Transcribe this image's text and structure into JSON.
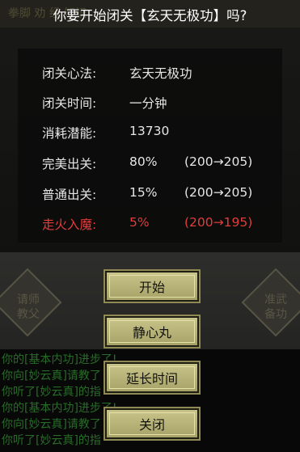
{
  "background": {
    "topbar_text": "拳脚            劝         经     知识",
    "left_badge": "请师\n教父",
    "right_badge": "准武\n备功",
    "log_lines": [
      {
        "text": "你的[基本内功]进步了!",
        "color": "#3fae3f"
      },
      {
        "text": "你向[妙云真]请教了        的疑问。",
        "color": "#3fae3f"
      },
      {
        "text": "你听了[妙云真]的指",
        "color": "#3fae3f"
      },
      {
        "text": "你的[基本内功]进步了!",
        "color": "#3fae3f"
      },
      {
        "text": "你向[妙云真]请教了        的疑问。",
        "color": "#3fae3f"
      },
      {
        "text": "你听了[妙云真]的指",
        "color": "#3fae3f"
      }
    ]
  },
  "dialog": {
    "title": "你要开始闭关【玄天无极功】吗?",
    "rows": [
      {
        "label": "闭关心法:",
        "value": "玄天无极功",
        "range": ""
      },
      {
        "label": "闭关时间:",
        "value": "一分钟",
        "range": ""
      },
      {
        "label": "消耗潜能:",
        "value": "13730",
        "range": ""
      },
      {
        "label": "完美出关:",
        "value": "80%",
        "range": "(200→205)"
      },
      {
        "label": "普通出关:",
        "value": "15%",
        "range": "(200→205)"
      },
      {
        "label": "走火入魔:",
        "value": "5%",
        "range": "(200→195)"
      }
    ],
    "buttons": {
      "start": "开始",
      "calm_pill": "静心丸",
      "extend": "延长时间",
      "close": "关闭"
    }
  },
  "colors": {
    "normal_text": "#e6e6e6",
    "danger_text": "#e23c3c",
    "button_face": "#c0bc80"
  }
}
